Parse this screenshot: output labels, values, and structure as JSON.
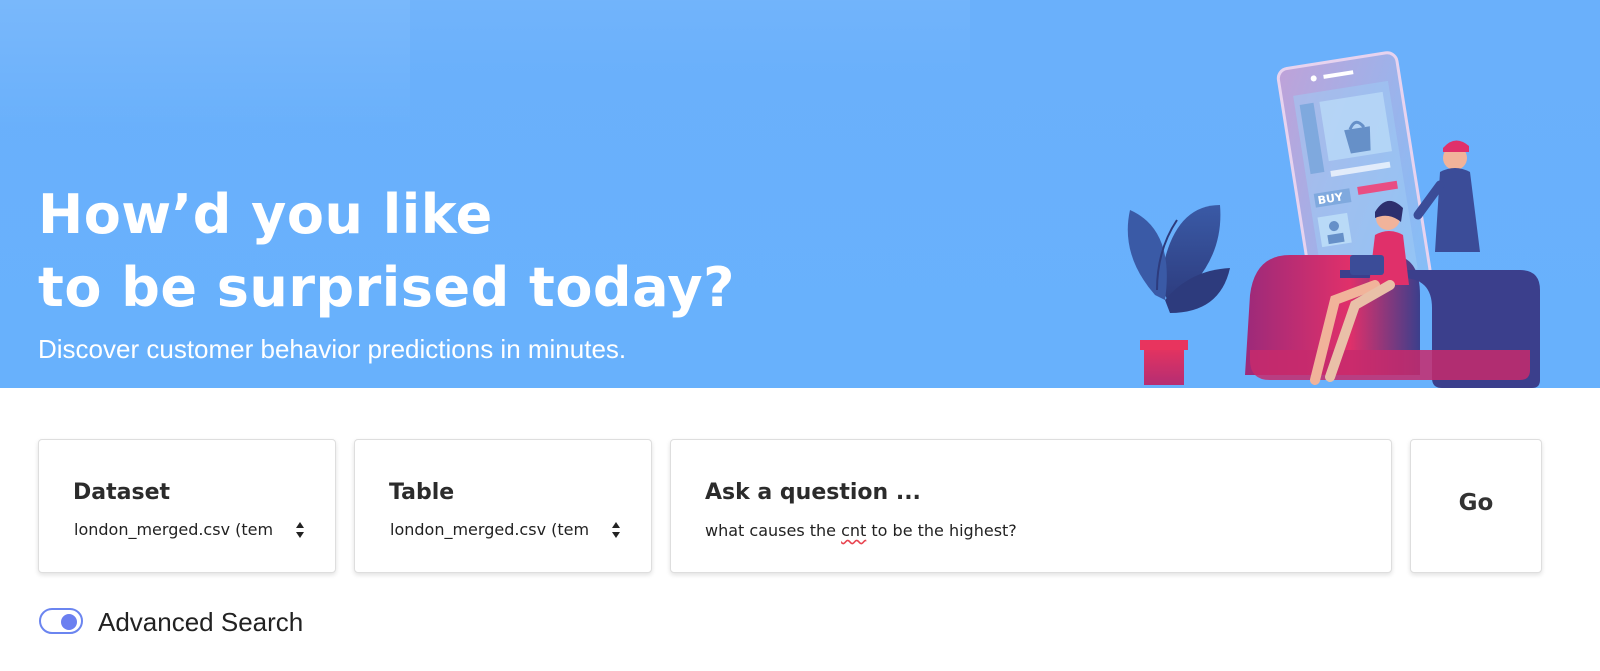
{
  "hero": {
    "title_line1": "How’d you like",
    "title_line2": "to be surprised today?",
    "subtitle": "Discover customer behavior predictions in minutes.",
    "illustration_badge": "BUY"
  },
  "search": {
    "dataset": {
      "label": "Dataset",
      "value": "london_merged.csv (tem"
    },
    "table": {
      "label": "Table",
      "value": "london_merged.csv (tem"
    },
    "question": {
      "label": "Ask a question ...",
      "value_prefix": "what causes the ",
      "value_misspelled": "cnt",
      "value_suffix": " to be the highest?"
    },
    "go_label": "Go"
  },
  "advanced_search": {
    "label": "Advanced Search",
    "enabled": true
  },
  "colors": {
    "hero_bg": "#68b1fc",
    "toggle_accent": "#6b7ff0",
    "card_border": "#dedede"
  }
}
